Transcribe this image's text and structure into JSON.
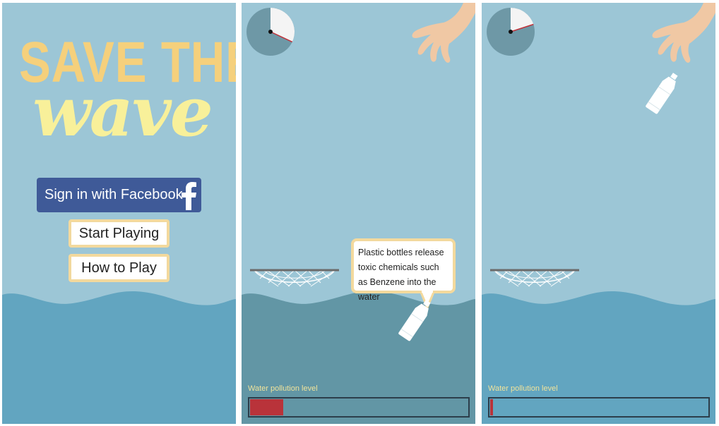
{
  "menu": {
    "title_line1": "SAVE THE",
    "title_line2": "wave",
    "facebook_button": "Sign in with Facebook",
    "facebook_glyph": "f",
    "start_button": "Start Playing",
    "howto_button": "How to Play"
  },
  "game_1": {
    "bubble_text": "Plastic bottles release toxic chemicals such as Benzene into the water",
    "pollution_label": "Water pollution level",
    "pollution_level": 0.15,
    "timer_elapsed_fraction": 0.32
  },
  "game_2": {
    "pollution_label": "Water pollution level",
    "pollution_level": 0.012,
    "timer_elapsed_fraction": 0.2
  },
  "colors": {
    "sky": "#9cc6d6",
    "water": "#62a5c0",
    "water_dark": "#6296a5",
    "title_yellow": "#f5d07c",
    "facebook_blue": "#3f5a98",
    "button_border": "#f3d99d",
    "pollution_red": "#b9333a",
    "timer_grey": "#6e98a6",
    "hand_skin": "#f0c8a4"
  },
  "icons": {
    "facebook": "facebook-f-icon",
    "timer": "pie-timer-icon",
    "hand": "hand-icon",
    "net": "fishing-net-icon",
    "bottle": "plastic-bottle-icon"
  }
}
